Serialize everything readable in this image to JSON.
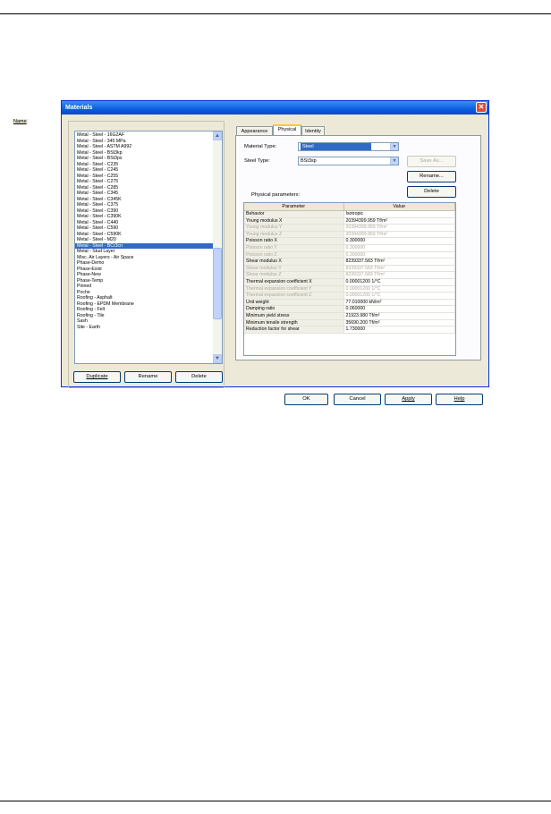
{
  "window": {
    "title": "Materials"
  },
  "name_group": {
    "label": "Name"
  },
  "materials": [
    "Metal - Steel - 16G2AF",
    "Metal - Steel - 345 MPa",
    "Metal - Steel - ASTM A992",
    "Metal - Steel - BSt3kp",
    "Metal - Steel - BSt3ps",
    "Metal - Steel - C235",
    "Metal - Steel - C245",
    "Metal - Steel - C255",
    "Metal - Steel - C275",
    "Metal - Steel - C285",
    "Metal - Steel - C345",
    "Metal - Steel - C345K",
    "Metal - Steel - C375",
    "Metal - Steel - C390",
    "Metal - Steel - C390K",
    "Metal - Steel - C440",
    "Metal - Steel - C590",
    "Metal - Steel - C590K",
    "Metal - Steel - M20",
    "Metal - Steel - BCr3cn",
    "Metal - Stud Layer",
    "Misc. Air Layers - Air Space",
    "Phase-Demo",
    "Phase-Exist",
    "Phase-New",
    "Phase-Temp",
    "Pinned",
    "Poche",
    "Roofing - Asphalt",
    "Roofing - EPDM Membrane",
    "Roofing - Felt",
    "Roofing - Tile",
    "Sash",
    "Site - Earth"
  ],
  "selected_index": 19,
  "left_buttons": {
    "duplicate": "Duplicate",
    "rename": "Rename",
    "delete": "Delete"
  },
  "tabs": {
    "appearance": "Appearance",
    "physical": "Physical",
    "identity": "Identity"
  },
  "active_tab": "Physical",
  "material_type": {
    "label": "Material Type:",
    "value": "Steel"
  },
  "steel_type": {
    "label": "Steel Type:",
    "value": "BSt3sp"
  },
  "right_buttons": {
    "save_as": "Save As...",
    "rename": "Rename...",
    "delete": "Delete"
  },
  "params": {
    "label": "Physical parameters:",
    "columns": [
      "Parameter",
      "Value"
    ],
    "rows": [
      {
        "name": "Behavior",
        "value": "Isotropic",
        "enabled": true
      },
      {
        "name": "Young modulus X",
        "value": "20394399.959 Tf/m²",
        "enabled": true
      },
      {
        "name": "Young modulus Y",
        "value": "20394399.959 Tf/m²",
        "enabled": false
      },
      {
        "name": "Young modulus Z",
        "value": "20394399.959 Tf/m²",
        "enabled": false
      },
      {
        "name": "Poisson ratio X",
        "value": "0.300000",
        "enabled": true
      },
      {
        "name": "Poisson ratio Y",
        "value": "0.300000",
        "enabled": false
      },
      {
        "name": "Poisson ratio Z",
        "value": "0.300000",
        "enabled": false
      },
      {
        "name": "Shear modulus X",
        "value": "8239337.583 Tf/m²",
        "enabled": true
      },
      {
        "name": "Shear modulus Y",
        "value": "8239337.583 Tf/m²",
        "enabled": false
      },
      {
        "name": "Shear modulus Z",
        "value": "8239337.583 Tf/m²",
        "enabled": false
      },
      {
        "name": "Thermal expansion coefficient X",
        "value": "0.00001200 1/°C",
        "enabled": true
      },
      {
        "name": "Thermal expansion coefficient Y",
        "value": "0.00001200 1/°C",
        "enabled": false
      },
      {
        "name": "Thermal expansion coefficient Z",
        "value": "0.00001200 1/°C",
        "enabled": false
      },
      {
        "name": "Unit weight",
        "value": "77.010000 kN/m³",
        "enabled": true
      },
      {
        "name": "Damping ratio",
        "value": "0.060000",
        "enabled": true
      },
      {
        "name": "Minimum yield stress",
        "value": "21923.980 Tf/m²",
        "enabled": true
      },
      {
        "name": "Minimum tensile strength",
        "value": "35690.200 Tf/m²",
        "enabled": true
      },
      {
        "name": "Reduction factor for shear",
        "value": "1.730000",
        "enabled": true
      }
    ]
  },
  "footer_buttons": {
    "ok": "OK",
    "cancel": "Cancel",
    "apply": "Apply",
    "help": "Help"
  },
  "colors": {
    "selection": "#316ac5",
    "titlebar": "#0a5de0",
    "dialog_bg": "#ece9d8"
  }
}
